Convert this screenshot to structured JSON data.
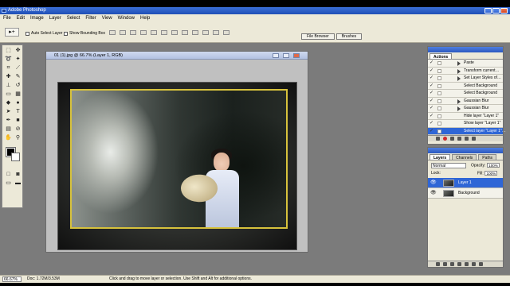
{
  "app": {
    "title": "Adobe Photoshop",
    "menu": [
      "File",
      "Edit",
      "Image",
      "Layer",
      "Select",
      "Filter",
      "View",
      "Window",
      "Help"
    ]
  },
  "options": {
    "tool_glyph": "▸+",
    "auto_select": "Auto Select Layer",
    "bounding_box": "Show Bounding Box",
    "well_tabs": [
      "File Browser",
      "Brushes"
    ]
  },
  "document": {
    "title": "01 (1).jpg @ 66.7% (Layer 1, RGB)"
  },
  "actions_panel": {
    "tab": "Actions",
    "rows": [
      {
        "label": "Paste",
        "expand": true,
        "selected": false
      },
      {
        "label": "Transform current…",
        "expand": true,
        "selected": false
      },
      {
        "label": "Set Layer Styles of…",
        "expand": true,
        "selected": false
      },
      {
        "label": "Select Background",
        "expand": false,
        "selected": false
      },
      {
        "label": "Select Background",
        "expand": false,
        "selected": false
      },
      {
        "label": "Gaussian Blur",
        "expand": true,
        "selected": false
      },
      {
        "label": "Gaussian Blur",
        "expand": true,
        "selected": false
      },
      {
        "label": "Hide layer \"Layer 1\"",
        "expand": false,
        "selected": false
      },
      {
        "label": "Show layer \"Layer 1\"",
        "expand": false,
        "selected": false
      },
      {
        "label": "Select layer \"Layer 1\"…",
        "expand": false,
        "selected": true
      }
    ]
  },
  "layers_panel": {
    "tabs": [
      "Layers",
      "Channels",
      "Paths"
    ],
    "blend_mode": "Normal",
    "opacity_label": "Opacity:",
    "opacity": "100%",
    "lock_label": "Lock:",
    "fill_label": "Fill:",
    "fill": "100%",
    "layers": [
      {
        "name": "Layer 1",
        "selected": true
      },
      {
        "name": "Background",
        "selected": false
      }
    ]
  },
  "status": {
    "zoom": "66.67%",
    "doc": "Doc: 1.72M/3.53M",
    "hint": "Click and drag to move layer or selection.  Use Shift and Alt for additional options."
  }
}
